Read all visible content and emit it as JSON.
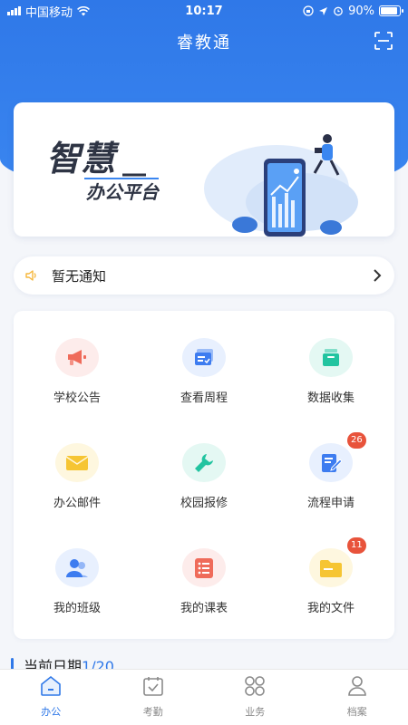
{
  "status_bar": {
    "carrier": "中国移动",
    "time": "10:17",
    "battery": "90%",
    "battery_level": 0.9
  },
  "header": {
    "title": "睿教通",
    "scan_icon": "scan-icon"
  },
  "banner": {
    "title": "智慧",
    "subtitle": "办公平台"
  },
  "notice": {
    "text": "暂无通知",
    "speaker_icon": "speaker-icon",
    "arrow_icon": "chevron-right-icon"
  },
  "menu": {
    "items": [
      {
        "label": "学校公告",
        "icon": "megaphone-icon",
        "color": "#ef6b5a",
        "halo": "#fdeceb",
        "badge": ""
      },
      {
        "label": "查看周程",
        "icon": "schedule-card-icon",
        "color": "#3d7cf0",
        "halo": "#e8f0fe",
        "badge": ""
      },
      {
        "label": "数据收集",
        "icon": "collect-box-icon",
        "color": "#22c4a0",
        "halo": "#e4f8f3",
        "badge": ""
      },
      {
        "label": "办公邮件",
        "icon": "mail-icon",
        "color": "#f6c533",
        "halo": "#fef7df",
        "badge": ""
      },
      {
        "label": "校园报修",
        "icon": "wrench-icon",
        "color": "#22c4a0",
        "halo": "#e4f8f3",
        "badge": ""
      },
      {
        "label": "流程申请",
        "icon": "document-edit-icon",
        "color": "#3d7cf0",
        "halo": "#e8f0fe",
        "badge": "26"
      },
      {
        "label": "我的班级",
        "icon": "people-icon",
        "color": "#3d7cf0",
        "halo": "#e8f0fe",
        "badge": ""
      },
      {
        "label": "我的课表",
        "icon": "list-icon",
        "color": "#ef6b5a",
        "halo": "#fdeceb",
        "badge": ""
      },
      {
        "label": "我的文件",
        "icon": "folder-icon",
        "color": "#f6c533",
        "halo": "#fef7df",
        "badge": "11"
      }
    ]
  },
  "date_section": {
    "label": "当前日期",
    "value": "1/20"
  },
  "tabs": [
    {
      "label": "办公",
      "icon": "home-icon",
      "active": true
    },
    {
      "label": "考勤",
      "icon": "calendar-check-icon",
      "active": false
    },
    {
      "label": "业务",
      "icon": "grid-circles-icon",
      "active": false
    },
    {
      "label": "档案",
      "icon": "profile-icon",
      "active": false
    }
  ],
  "colors": {
    "primary": "#2f78e8",
    "badge": "#e8533b"
  }
}
